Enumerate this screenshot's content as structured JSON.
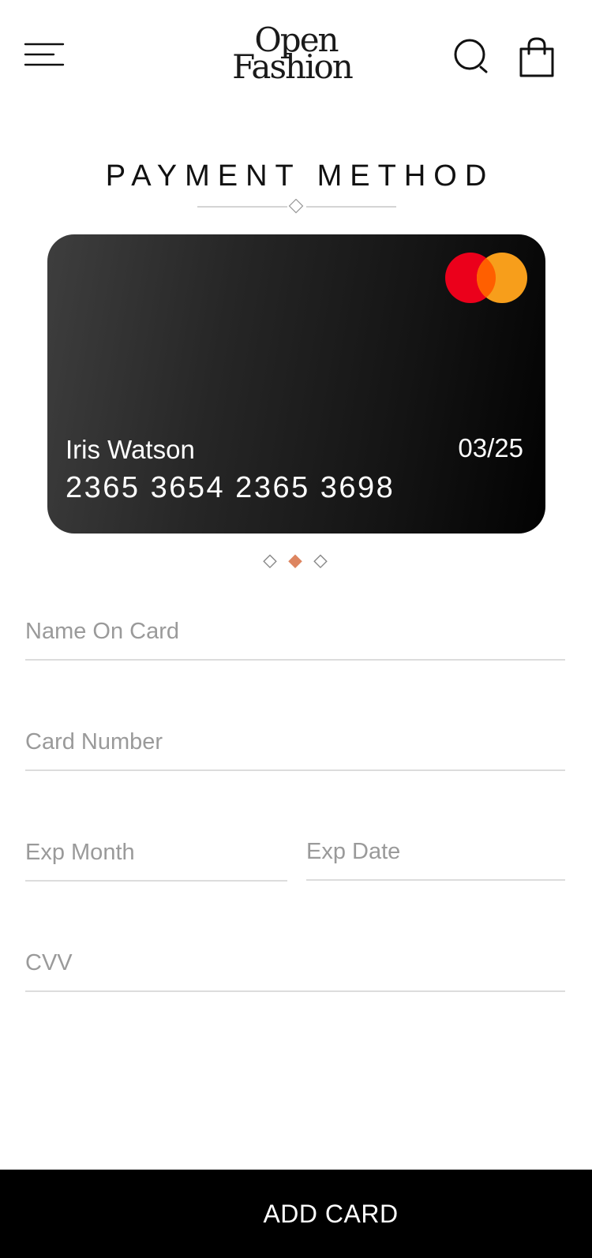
{
  "header": {
    "logo_line1": "Open",
    "logo_line2": "Fashion",
    "menu_icon": "hamburger-menu-icon",
    "search_icon": "search-icon",
    "bag_icon": "shopping-bag-icon"
  },
  "page": {
    "title": "PAYMENT METHOD"
  },
  "card": {
    "holder": "Iris Watson",
    "expiry": "03/25",
    "number": "2365 3654 2365 3698",
    "brand_icon": "mastercard-logo",
    "colors": {
      "mastercard_red": "#EB001B",
      "mastercard_orange": "#F79E1B"
    }
  },
  "carousel": {
    "total": 3,
    "active_index": 1,
    "active_color": "#DD8560"
  },
  "form": {
    "name_placeholder": "Name On Card",
    "number_placeholder": "Card Number",
    "exp_month_placeholder": "Exp Month",
    "exp_date_placeholder": "Exp Date",
    "cvv_placeholder": "CVV"
  },
  "actions": {
    "add_card_label": "ADD CARD"
  }
}
